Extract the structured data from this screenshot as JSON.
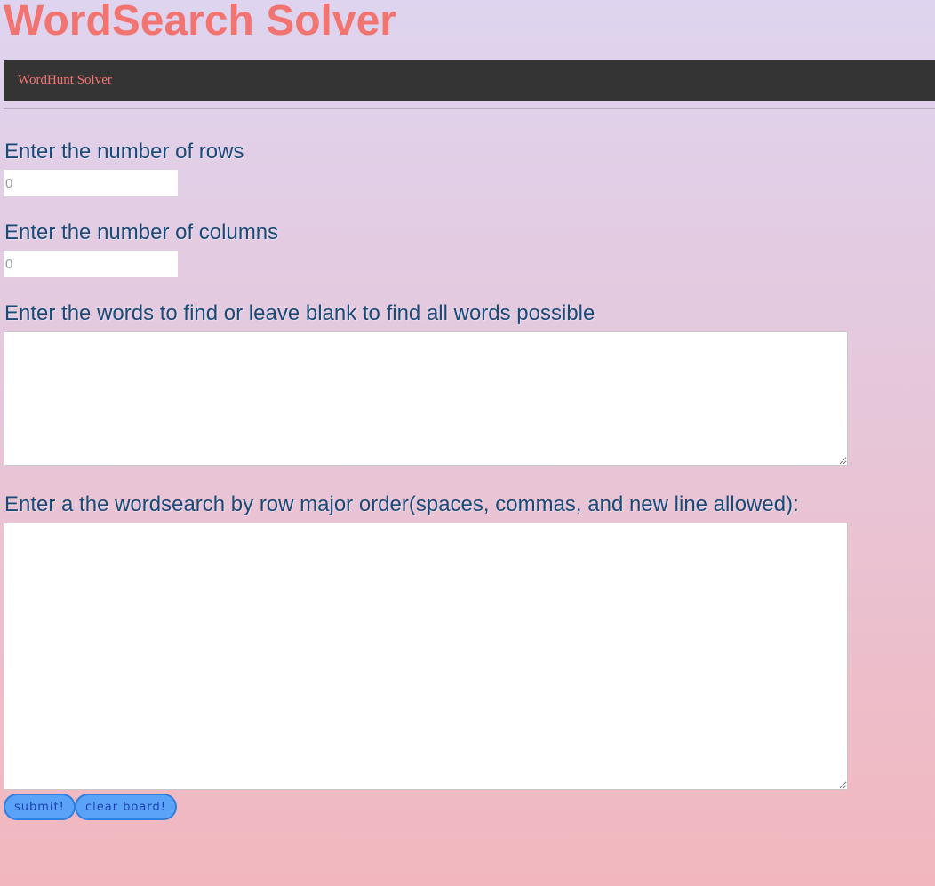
{
  "header": {
    "title": "WordSearch Solver"
  },
  "navbar": {
    "links": [
      {
        "label": "WordHunt Solver"
      }
    ]
  },
  "form": {
    "rows": {
      "label": "Enter the number of rows",
      "placeholder": "0",
      "value": ""
    },
    "columns": {
      "label": "Enter the number of columns",
      "placeholder": "0",
      "value": ""
    },
    "words": {
      "label": "Enter the words to find or leave blank to find all words possible",
      "value": ""
    },
    "board": {
      "label": "Enter a the wordsearch by row major order(spaces, commas, and new line allowed):",
      "value": ""
    },
    "buttons": {
      "submit": "submit!",
      "clear": "clear board!"
    }
  },
  "colors": {
    "title": "#f27471",
    "navbar_bg": "#343434",
    "label_text": "#1a4a78",
    "button_bg": "#5aa3f8",
    "button_border": "#2f7fe0",
    "button_text": "#1f3fb0",
    "background_top": "#ded4ef",
    "background_bottom": "#f2b7be"
  }
}
